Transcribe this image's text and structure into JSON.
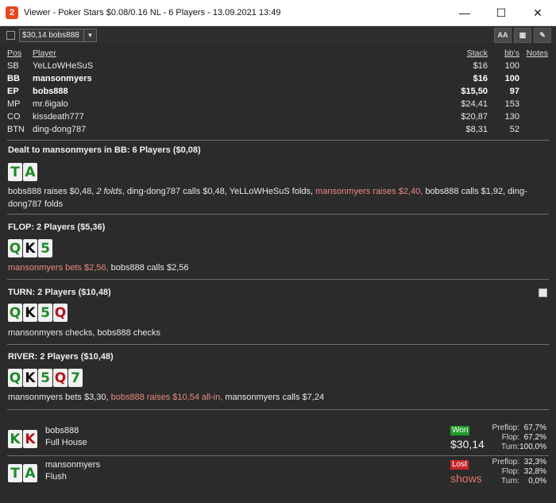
{
  "window": {
    "title": "Viewer - Poker Stars $0.08/0.16 NL - 6 Players - 13.09.2021 13:49",
    "app_icon": "2",
    "minimize": "—",
    "maximize": "☐",
    "close": "✕"
  },
  "toolbar": {
    "hand_select_value": "$30,14 bobs888",
    "font_button": "AA",
    "grid_button": "▦",
    "edit_button": "✎"
  },
  "players_header": {
    "pos": "Pos",
    "player": "Player",
    "stack": "Stack",
    "bbs": "bb's",
    "notes": "Notes"
  },
  "players": [
    {
      "pos": "SB",
      "name": "YeLLoWHeSuS",
      "stack": "$16",
      "bbs": "100",
      "bold": false
    },
    {
      "pos": "BB",
      "name": "mansonmyers",
      "stack": "$16",
      "bbs": "100",
      "bold": true
    },
    {
      "pos": "EP",
      "name": "bobs888",
      "stack": "$15,50",
      "bbs": "97",
      "bold": true
    },
    {
      "pos": "MP",
      "name": "mr.6igalo",
      "stack": "$24,41",
      "bbs": "153",
      "bold": false
    },
    {
      "pos": "CO",
      "name": "kissdeath777",
      "stack": "$20,87",
      "bbs": "130",
      "bold": false
    },
    {
      "pos": "BTN",
      "name": "ding-dong787",
      "stack": "$8,31",
      "bbs": "52",
      "bold": false
    }
  ],
  "preflop": {
    "title": "Dealt to mansonmyers in BB: 6 Players ($0,08)",
    "cards": [
      {
        "rank": "T",
        "color": "green"
      },
      {
        "rank": "A",
        "color": "green"
      }
    ],
    "actions": [
      {
        "text": "bobs888 raises $0,48, ",
        "style": ""
      },
      {
        "text": "2 folds",
        "style": "ital"
      },
      {
        "text": ", ding-dong787 calls $0,48, YeLLoWHeSuS folds, ",
        "style": ""
      },
      {
        "text": "mansonmyers raises $2,40,",
        "style": "hl"
      },
      {
        "text": " bobs888 calls $1,92, ding-dong787 folds",
        "style": ""
      }
    ]
  },
  "flop": {
    "title": "FLOP: 2 Players ($5,36)",
    "cards": [
      {
        "rank": "Q",
        "color": "green"
      },
      {
        "rank": "K",
        "color": "black"
      },
      {
        "rank": "5",
        "color": "green"
      }
    ],
    "actions": [
      {
        "text": "mansonmyers bets $2,56,",
        "style": "hl"
      },
      {
        "text": " bobs888 calls $2,56",
        "style": ""
      }
    ]
  },
  "turn": {
    "title": "TURN: 2 Players ($10,48)",
    "cards": [
      {
        "rank": "Q",
        "color": "green"
      },
      {
        "rank": "K",
        "color": "black"
      },
      {
        "rank": "5",
        "color": "green"
      },
      {
        "rank": "Q",
        "color": "red"
      }
    ],
    "actions": [
      {
        "text": "mansonmyers checks, bobs888 checks",
        "style": ""
      }
    ]
  },
  "river": {
    "title": "RIVER: 2 Players ($10,48)",
    "cards": [
      {
        "rank": "Q",
        "color": "green"
      },
      {
        "rank": "K",
        "color": "black"
      },
      {
        "rank": "5",
        "color": "green"
      },
      {
        "rank": "Q",
        "color": "red"
      },
      {
        "rank": "7",
        "color": "green"
      }
    ],
    "actions": [
      {
        "text": "mansonmyers bets $3,30, ",
        "style": ""
      },
      {
        "text": "bobs888 raises $10,54 all-in,",
        "style": "hl"
      },
      {
        "text": " mansonmyers calls $7,24",
        "style": ""
      }
    ]
  },
  "results": [
    {
      "name": "bobs888",
      "hand": "Full House",
      "cards": [
        {
          "rank": "K",
          "color": "green"
        },
        {
          "rank": "K",
          "color": "red"
        }
      ],
      "badge": "Won",
      "outcome": "won",
      "amount": "$30,14",
      "stats": [
        {
          "label": "Preflop:",
          "value": "67,7%"
        },
        {
          "label": "Flop:",
          "value": "67,2%"
        },
        {
          "label": "Turn:",
          "value": "100,0%"
        }
      ]
    },
    {
      "name": "mansonmyers",
      "hand": "Flush",
      "cards": [
        {
          "rank": "T",
          "color": "green"
        },
        {
          "rank": "A",
          "color": "green"
        }
      ],
      "badge": "Lost",
      "outcome": "lost",
      "amount": "shows",
      "stats": [
        {
          "label": "Preflop:",
          "value": "32,3%"
        },
        {
          "label": "Flop:",
          "value": "32,8%"
        },
        {
          "label": "Turn:",
          "value": "0,0%"
        }
      ]
    }
  ],
  "colors": {
    "background": "#2b2b2b",
    "highlight": "#e98a7f",
    "won": "#1f9a2a",
    "lost": "#c9262a"
  }
}
